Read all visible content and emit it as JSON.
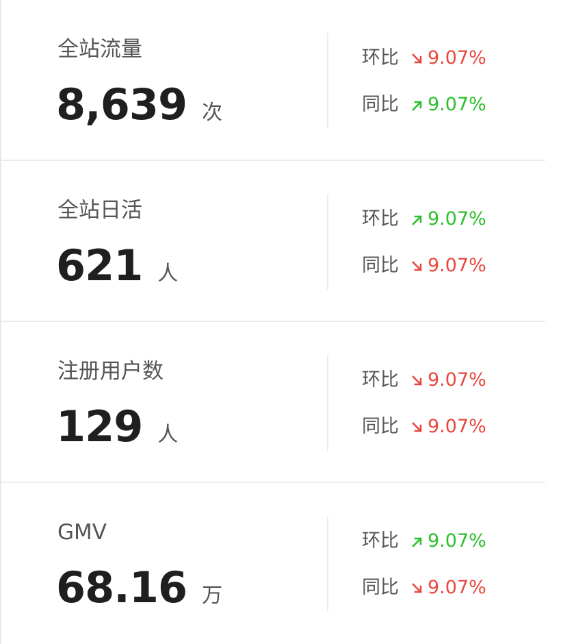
{
  "colors": {
    "down": "#e8473f",
    "up": "#2bbf2b",
    "value": "#1f1f1f",
    "label": "#555555"
  },
  "metrics": [
    {
      "name": "全站流量",
      "value": "8,639",
      "unit": "次",
      "mom": {
        "label": "环比",
        "direction": "down",
        "icon": "arrow-down-right-icon",
        "value": "9.07%"
      },
      "yoy": {
        "label": "同比",
        "direction": "up",
        "icon": "arrow-up-right-icon",
        "value": "9.07%"
      }
    },
    {
      "name": "全站日活",
      "value": "621",
      "unit": "人",
      "mom": {
        "label": "环比",
        "direction": "up",
        "icon": "arrow-up-right-icon",
        "value": "9.07%"
      },
      "yoy": {
        "label": "同比",
        "direction": "down",
        "icon": "arrow-down-right-icon",
        "value": "9.07%"
      }
    },
    {
      "name": "注册用户数",
      "value": "129",
      "unit": "人",
      "mom": {
        "label": "环比",
        "direction": "down",
        "icon": "arrow-down-right-icon",
        "value": "9.07%"
      },
      "yoy": {
        "label": "同比",
        "direction": "down",
        "icon": "arrow-down-right-icon",
        "value": "9.07%"
      }
    },
    {
      "name": "GMV",
      "value": "68.16",
      "unit": "万",
      "mom": {
        "label": "环比",
        "direction": "up",
        "icon": "arrow-up-right-icon",
        "value": "9.07%"
      },
      "yoy": {
        "label": "同比",
        "direction": "down",
        "icon": "arrow-down-right-icon",
        "value": "9.07%"
      }
    }
  ]
}
